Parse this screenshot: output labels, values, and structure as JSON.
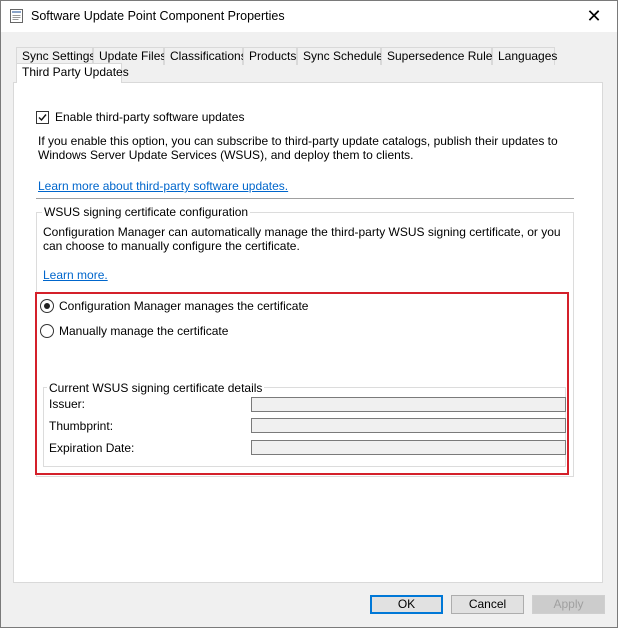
{
  "window": {
    "title": "Software Update Point Component Properties",
    "close_glyph": "✕"
  },
  "tabs": [
    {
      "label": "Sync Settings"
    },
    {
      "label": "Update Files"
    },
    {
      "label": "Classifications"
    },
    {
      "label": "Products"
    },
    {
      "label": "Sync Schedule"
    },
    {
      "label": "Supersedence Rules"
    },
    {
      "label": "Languages"
    },
    {
      "label": "Third Party Updates",
      "active": true
    }
  ],
  "third_party": {
    "enable_label": "Enable third-party software updates",
    "enable_checked": true,
    "description": "If you enable this option, you can subscribe to third-party update catalogs, publish their updates to Windows Server Update Services (WSUS), and deploy them to clients.",
    "learn_more_link": "Learn more about third-party software updates."
  },
  "signing": {
    "group_label": "WSUS signing certificate configuration",
    "description": "Configuration Manager can automatically manage the third-party WSUS signing certificate, or you can choose to manually configure the certificate.",
    "learn_more_link": "Learn more.",
    "option_managed": "Configuration Manager manages the certificate",
    "option_manual": "Manually manage the certificate",
    "selected": "managed",
    "details": {
      "group_label": "Current WSUS signing certificate details",
      "issuer_label": "Issuer:",
      "issuer_value": "",
      "thumbprint_label": "Thumbprint:",
      "thumbprint_value": "",
      "expiration_label": "Expiration Date:",
      "expiration_value": ""
    }
  },
  "buttons": {
    "ok": "OK",
    "cancel": "Cancel",
    "apply": "Apply"
  },
  "colors": {
    "highlight": "#d4202a",
    "link": "#0066cc",
    "default_button_border": "#0078d7"
  }
}
